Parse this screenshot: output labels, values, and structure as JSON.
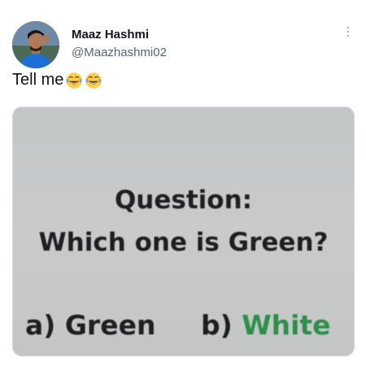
{
  "tweet": {
    "author_name": "Maaz Hashmi",
    "author_handle": "@Maazhashmi02",
    "text": "Tell me",
    "emojis": [
      "face-with-tears-of-joy-icon",
      "face-with-tears-of-joy-icon"
    ],
    "media": {
      "question_label": "Question:",
      "question_text": "Which one is Green?",
      "option_a": "a) Green",
      "option_b_prefix": "b) ",
      "option_b_word": "White",
      "option_b_word_color": "#2e8f4a"
    }
  },
  "colors": {
    "text_primary": "#0f1419",
    "text_secondary": "#536471",
    "media_background": "#c6c8c8"
  }
}
